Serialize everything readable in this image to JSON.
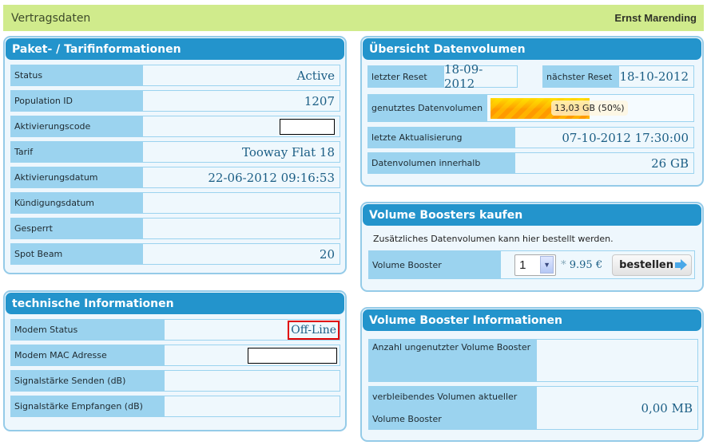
{
  "header": {
    "title": "Vertragsdaten",
    "user": "Ernst Marending"
  },
  "tariff": {
    "title": "Paket- / Tarifinformationen",
    "rows": [
      {
        "label": "Status",
        "value": "Active"
      },
      {
        "label": "Population ID",
        "value": "1207"
      },
      {
        "label": "Aktivierungscode",
        "value": ""
      },
      {
        "label": "Tarif",
        "value": "Tooway Flat 18"
      },
      {
        "label": "Aktivierungsdatum",
        "value": "22-06-2012 09:16:53"
      },
      {
        "label": "Kündigungsdatum",
        "value": ""
      },
      {
        "label": "Gesperrt",
        "value": ""
      },
      {
        "label": "Spot Beam",
        "value": "20"
      }
    ]
  },
  "technical": {
    "title": "technische Informationen",
    "rows": [
      {
        "label": "Modem Status",
        "value": "Off-Line"
      },
      {
        "label": "Modem MAC Adresse",
        "value": ""
      },
      {
        "label": "Signalstärke Senden (dB)",
        "value": ""
      },
      {
        "label": "Signalstärke Empfangen (dB)",
        "value": ""
      }
    ]
  },
  "volume": {
    "title": "Übersicht Datenvolumen",
    "last_reset_label": "letzter Reset",
    "last_reset": "18-09-2012",
    "next_reset_label": "nächster Reset",
    "next_reset": "18-10-2012",
    "used_label": "genutztes Datenvolumen",
    "used_text": "13,03 GB (50%)",
    "used_percent": 50,
    "updated_label": "letzte Aktualisierung",
    "updated": "07-10-2012 17:30:00",
    "quota_label": "Datenvolumen innerhalb",
    "quota": "26 GB"
  },
  "booster_buy": {
    "title": "Volume Boosters kaufen",
    "description": "Zusätzliches Datenvolumen kann hier bestellt werden.",
    "label": "Volume Booster",
    "quantity": "1",
    "price_prefix": "*",
    "price": "9.95 €",
    "order_label": "bestellen"
  },
  "booster_info": {
    "title": "Volume Booster Informationen",
    "unused_label": "Anzahl ungenutzter Volume Booster",
    "unused_value": "",
    "remaining_label_1": "verbleibendes Volumen aktueller",
    "remaining_label_2": "Volume Booster",
    "remaining_value": "0,00 MB"
  }
}
